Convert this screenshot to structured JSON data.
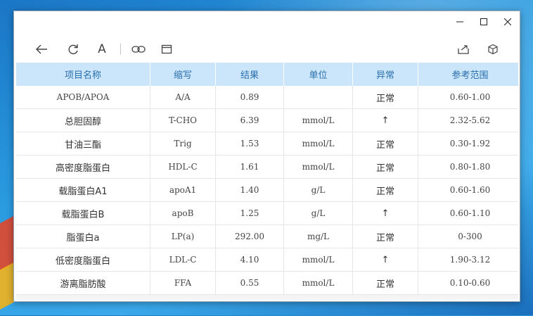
{
  "window": {
    "controls": {
      "minimize": "—",
      "maximize": "☐",
      "close": "✕"
    }
  },
  "toolbar": {
    "icons": [
      "back-arrow-icon",
      "refresh-icon",
      "font-icon",
      "link-icon",
      "window-icon",
      "share-icon",
      "cube-icon"
    ],
    "font_label": "A"
  },
  "table": {
    "headers": [
      "项目名称",
      "缩写",
      "结果",
      "单位",
      "异常",
      "参考范围"
    ],
    "rows": [
      [
        "APOB/APOA",
        "A/A",
        "0.89",
        "",
        "正常",
        "0.60-1.00"
      ],
      [
        "总胆固醇",
        "T-CHO",
        "6.39",
        "mmol/L",
        "↑",
        "2.32-5.62"
      ],
      [
        "甘油三酯",
        "Trig",
        "1.53",
        "mmol/L",
        "正常",
        "0.30-1.92"
      ],
      [
        "高密度脂蛋白",
        "HDL-C",
        "1.61",
        "mmol/L",
        "正常",
        "0.80-1.80"
      ],
      [
        "载脂蛋白A1",
        "apoA1",
        "1.40",
        "g/L",
        "正常",
        "0.60-1.60"
      ],
      [
        "载脂蛋白B",
        "apoB",
        "1.25",
        "g/L",
        "↑",
        "0.60-1.10"
      ],
      [
        "脂蛋白a",
        "LP(a)",
        "292.00",
        "mg/L",
        "正常",
        "0-300"
      ],
      [
        "低密度脂蛋白",
        "LDL-C",
        "4.10",
        "mmol/L",
        "↑",
        "1.90-3.12"
      ],
      [
        "游离脂肪酸",
        "FFA",
        "0.55",
        "mmol/L",
        "正常",
        "0.10-0.60"
      ]
    ]
  },
  "colors": {
    "header_bg": "#cbe6fa",
    "header_text": "#2b6fae"
  }
}
